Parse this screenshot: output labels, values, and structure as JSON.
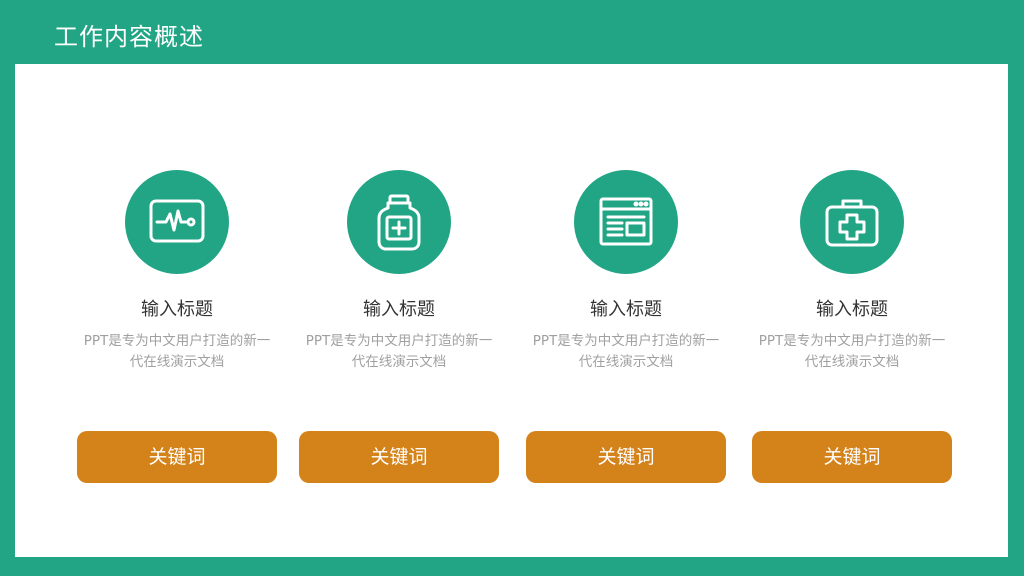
{
  "slide": {
    "title": "工作内容概述"
  },
  "theme": {
    "accent": "#22a585",
    "button": "#d4821a",
    "title_text": "#333333",
    "desc_text": "#a0a0a0"
  },
  "items": [
    {
      "icon": "ecg-monitor-icon",
      "title": "输入标题",
      "desc": "PPT是专为中文用户打造的新一代在线演示文档",
      "button": "关键词"
    },
    {
      "icon": "medicine-bottle-icon",
      "title": "输入标题",
      "desc": "PPT是专为中文用户打造的新一代在线演示文档",
      "button": "关键词"
    },
    {
      "icon": "browser-window-icon",
      "title": "输入标题",
      "desc": "PPT是专为中文用户打造的新一代在线演示文档",
      "button": "关键词"
    },
    {
      "icon": "first-aid-kit-icon",
      "title": "输入标题",
      "desc": "PPT是专为中文用户打造的新一代在线演示文档",
      "button": "关键词"
    }
  ]
}
